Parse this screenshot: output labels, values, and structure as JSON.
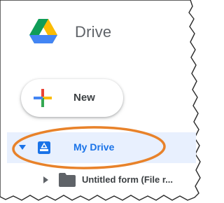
{
  "app": {
    "title": "Drive",
    "logo_icon": "google-drive-logo-icon"
  },
  "sidebar": {
    "new_button": {
      "label": "New",
      "icon": "plus-icon"
    },
    "my_drive": {
      "label": "My Drive",
      "icon": "drive-icon",
      "expanded": true
    },
    "children": [
      {
        "label": "Untitled form (File r...",
        "icon": "folder-icon",
        "expanded": false
      }
    ]
  },
  "annotation": {
    "type": "ellipse-highlight",
    "color": "#e8822a"
  },
  "colors": {
    "accent": "#1a73e8",
    "selected_bg": "#e8f0fe",
    "text": "#3c4043",
    "muted": "#5f6368",
    "folder": "#5f6368"
  }
}
